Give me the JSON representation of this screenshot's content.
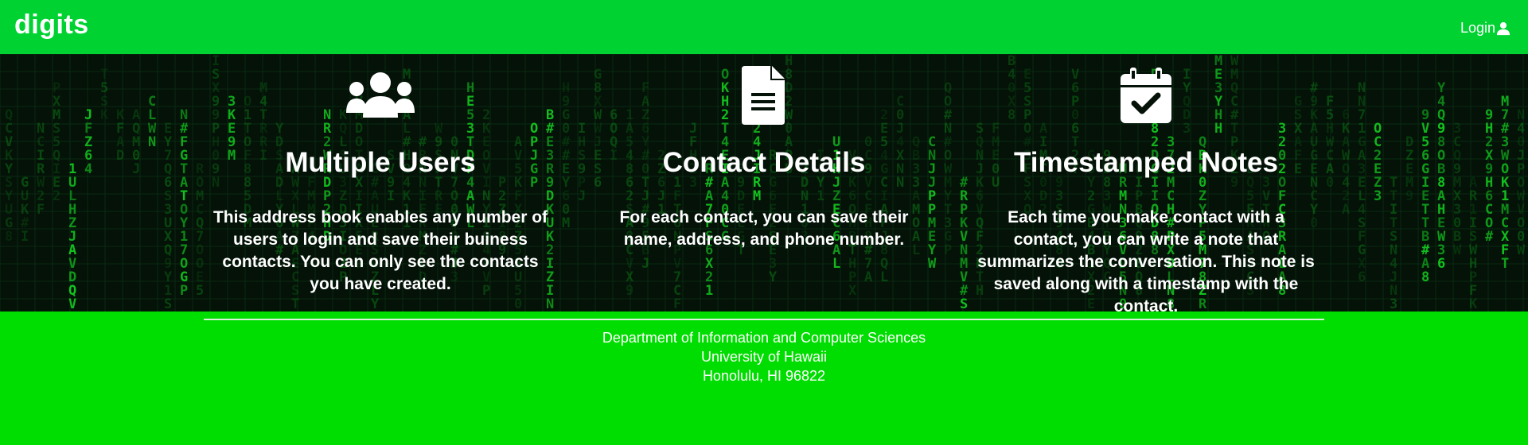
{
  "navbar": {
    "brand": "digits",
    "login_label": "Login",
    "login_icon": "user-icon"
  },
  "features": [
    {
      "icon": "users-icon",
      "title": "Multiple Users",
      "description": "This address book enables any number of users to login and save their buiness contacts. You can only see the contacts you have created."
    },
    {
      "icon": "file-text-icon",
      "title": "Contact Details",
      "description": "For each contact, you can save their name, address, and phone number."
    },
    {
      "icon": "calendar-check-icon",
      "title": "Timestamped Notes",
      "description": "Each time you make contact with a contact, you can write a note that summarizes the conversation. This note is saved along with a timestamp with the contact."
    }
  ],
  "footer": {
    "line1": "Department of Information and Computer Sciences",
    "line2": "University of Hawaii",
    "line3": "Honolulu, HI 96822"
  },
  "colors": {
    "navbar": "#00d232",
    "footer": "#00dd00",
    "hero_background": "#041208",
    "matrix_glyph": "#13c51f"
  }
}
